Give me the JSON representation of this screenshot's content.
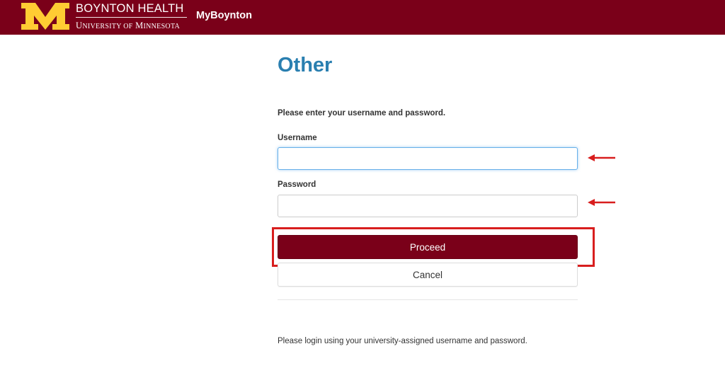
{
  "header": {
    "brand_top": "BOYNTON HEALTH",
    "brand_bottom_u": "U",
    "brand_bottom_niversity": "NIVERSITY OF",
    "brand_bottom_m": "M",
    "brand_bottom_innesota": "INNESOTA",
    "app_name": "MyBoynton",
    "color_bg": "#7a0019",
    "color_logo": "#ffcc33"
  },
  "form": {
    "title": "Other",
    "instructions": "Please enter your username and password.",
    "username_label": "Username",
    "username_value": "",
    "password_label": "Password",
    "password_value": "",
    "proceed_label": "Proceed",
    "cancel_label": "Cancel",
    "footer_note": "Please login using your university-assigned username and password."
  },
  "annotations": {
    "arrow_color": "#d81e1e",
    "box_color": "#d81e1e"
  }
}
